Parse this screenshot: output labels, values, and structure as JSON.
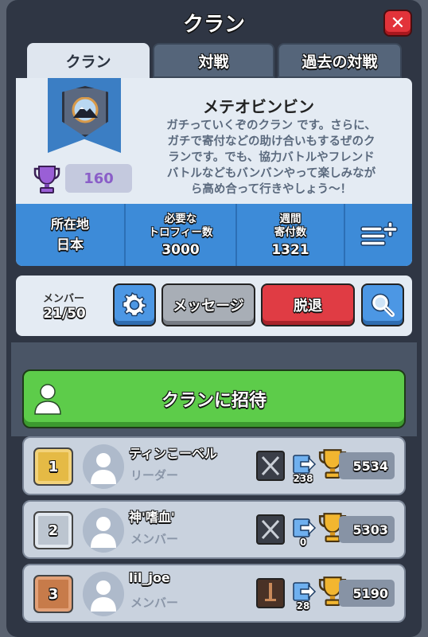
{
  "window": {
    "title": "クラン",
    "close_label": "✕"
  },
  "tabs": [
    {
      "label": "クラン",
      "active": true
    },
    {
      "label": "対戦",
      "active": false
    },
    {
      "label": "過去の対戦",
      "active": false
    }
  ],
  "clan": {
    "name": "メテオビンビン",
    "description_lines": [
      "ガチっていくぞのクラン です。さらに、",
      "ガチで寄付などの助け合いもするぜのク",
      "ランです。でも、協力バトルやフレンド",
      "バトルなどもバンバンやって楽しみなが",
      "ら高め合って行きやしょう〜！"
    ],
    "trophies": "160"
  },
  "stats": {
    "location_label": "所在地",
    "location_value": "日本",
    "required_label_1": "必要な",
    "required_label_2": "トロフィー数",
    "required_value": "3000",
    "weekly_label_1": "週間",
    "weekly_label_2": "寄付数",
    "weekly_value": "1321"
  },
  "members_bar": {
    "label": "メンバー",
    "count": "21/50",
    "message_label": "メッセージ",
    "leave_label": "脱退"
  },
  "invite": {
    "label": "クランに招待"
  },
  "members": [
    {
      "rank": "1",
      "name": "ティンこーベル",
      "role": "リーダー",
      "donations": "238",
      "trophies": "5534",
      "rank_style": "gold",
      "arena_color": "#3a3e48"
    },
    {
      "rank": "2",
      "name": "神'嗜血'",
      "role": "メンバー",
      "donations": "0",
      "trophies": "5303",
      "rank_style": "silver",
      "arena_color": "#3a3e48"
    },
    {
      "rank": "3",
      "name": "lil_joe",
      "role": "メンバー",
      "donations": "28",
      "trophies": "5190",
      "rank_style": "bronze",
      "arena_color": "#4a3226"
    }
  ],
  "colors": {
    "accent_blue": "#3d8bd8",
    "invite_green": "#5dcc4a",
    "leave_red": "#e03c44",
    "close_red": "#e2333a"
  }
}
